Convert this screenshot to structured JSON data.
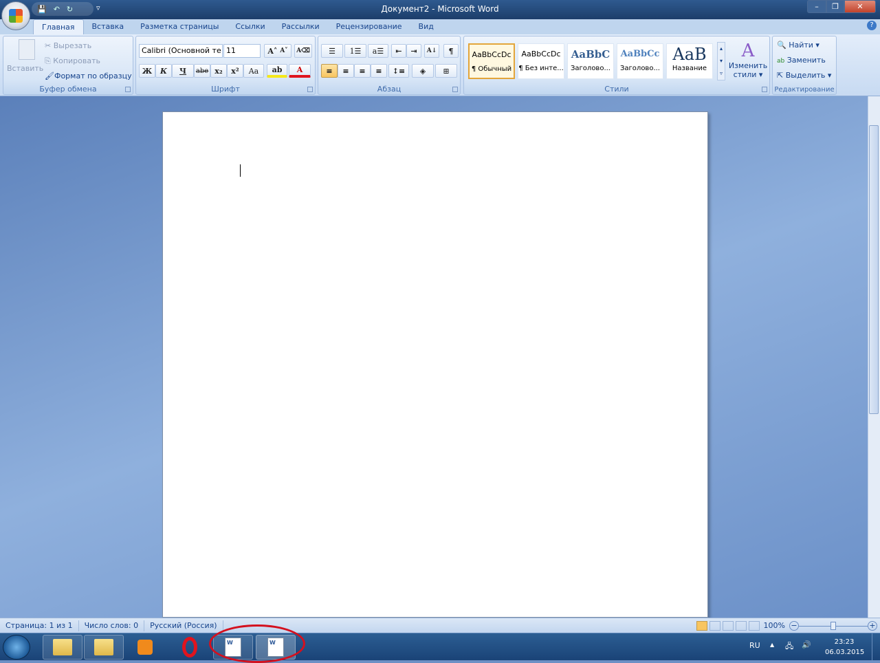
{
  "window": {
    "title": "Документ2 - Microsoft Word",
    "minimize": "–",
    "restore": "❐",
    "close": "✕"
  },
  "qat": {
    "save": "💾",
    "undo": "↶",
    "redo": "↻",
    "customize": "▿"
  },
  "tabs": [
    "Главная",
    "Вставка",
    "Разметка страницы",
    "Ссылки",
    "Рассылки",
    "Рецензирование",
    "Вид"
  ],
  "help": "?",
  "clipboard": {
    "label": "Буфер обмена",
    "paste": "Вставить",
    "cut": "Вырезать",
    "copy": "Копировать",
    "format_painter": "Формат по образцу"
  },
  "font": {
    "label": "Шрифт",
    "font_name": "Calibri (Основной те",
    "font_size": "11",
    "grow": "A˄",
    "shrink": "A˅",
    "clear": "A⌫",
    "bold": "Ж",
    "italic": "К",
    "underline": "Ч",
    "strike": "abe",
    "sub": "x₂",
    "sup": "x²",
    "case": "Aa",
    "highlight": "ab",
    "color": "A"
  },
  "paragraph": {
    "label": "Абзац",
    "bullets": "☰",
    "numbering": "1☰",
    "multilevel": "a☰",
    "outdent": "⇤",
    "indent": "⇥",
    "sort": "A↓",
    "pilcrow": "¶",
    "align_left": "≡",
    "center": "≡",
    "align_right": "≡",
    "justify": "≡",
    "spacing": "↕≡",
    "shading": "◈",
    "borders": "⊞"
  },
  "styles": {
    "label": "Стили",
    "items": [
      {
        "preview": "AaBbCcDc",
        "name": "¶ Обычный"
      },
      {
        "preview": "AaBbCcDc",
        "name": "¶ Без инте..."
      },
      {
        "preview": "AaBbC",
        "name": "Заголово..."
      },
      {
        "preview": "AaBbCc",
        "name": "Заголово..."
      },
      {
        "preview": "AaB",
        "name": "Название"
      }
    ],
    "change": "Изменить стили ▾"
  },
  "editing": {
    "label": "Редактирование",
    "find": "Найти ▾",
    "replace": "Заменить",
    "select": "Выделить ▾"
  },
  "status": {
    "page": "Страница: 1 из 1",
    "words": "Число слов: 0",
    "lang": "Русский (Россия)",
    "zoom": "100%",
    "zoom_percent": 100
  },
  "tray": {
    "lang": "RU",
    "time": "23:23",
    "date": "06.03.2015"
  }
}
